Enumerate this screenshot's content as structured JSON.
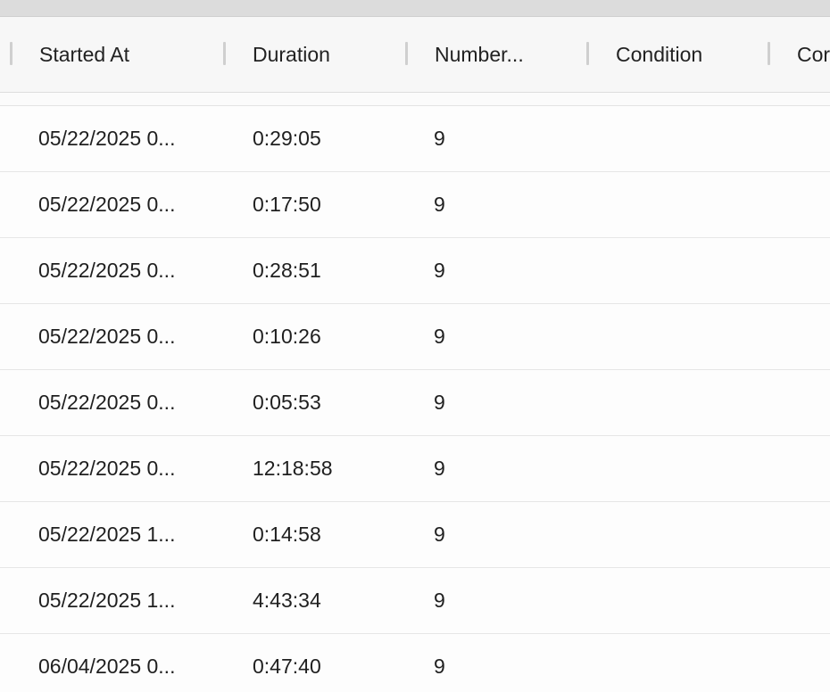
{
  "table": {
    "columns": [
      {
        "key": "started_at",
        "label": "Started At"
      },
      {
        "key": "duration",
        "label": "Duration"
      },
      {
        "key": "number",
        "label": "Number..."
      },
      {
        "key": "condition",
        "label": "Condition"
      },
      {
        "key": "cor",
        "label": "Cor"
      }
    ],
    "rows": [
      {
        "started_at": "05/22/2025 0...",
        "duration": "0:29:05",
        "number": "9",
        "condition": "",
        "cor": ""
      },
      {
        "started_at": "05/22/2025 0...",
        "duration": "0:17:50",
        "number": "9",
        "condition": "",
        "cor": ""
      },
      {
        "started_at": "05/22/2025 0...",
        "duration": "0:28:51",
        "number": "9",
        "condition": "",
        "cor": ""
      },
      {
        "started_at": "05/22/2025 0...",
        "duration": "0:10:26",
        "number": "9",
        "condition": "",
        "cor": ""
      },
      {
        "started_at": "05/22/2025 0...",
        "duration": "0:05:53",
        "number": "9",
        "condition": "",
        "cor": ""
      },
      {
        "started_at": "05/22/2025 0...",
        "duration": "12:18:58",
        "number": "9",
        "condition": "",
        "cor": ""
      },
      {
        "started_at": "05/22/2025 1...",
        "duration": "0:14:58",
        "number": "9",
        "condition": "",
        "cor": ""
      },
      {
        "started_at": "05/22/2025 1...",
        "duration": "4:43:34",
        "number": "9",
        "condition": "",
        "cor": ""
      },
      {
        "started_at": "06/04/2025 0...",
        "duration": "0:47:40",
        "number": "9",
        "condition": "",
        "cor": ""
      }
    ]
  }
}
